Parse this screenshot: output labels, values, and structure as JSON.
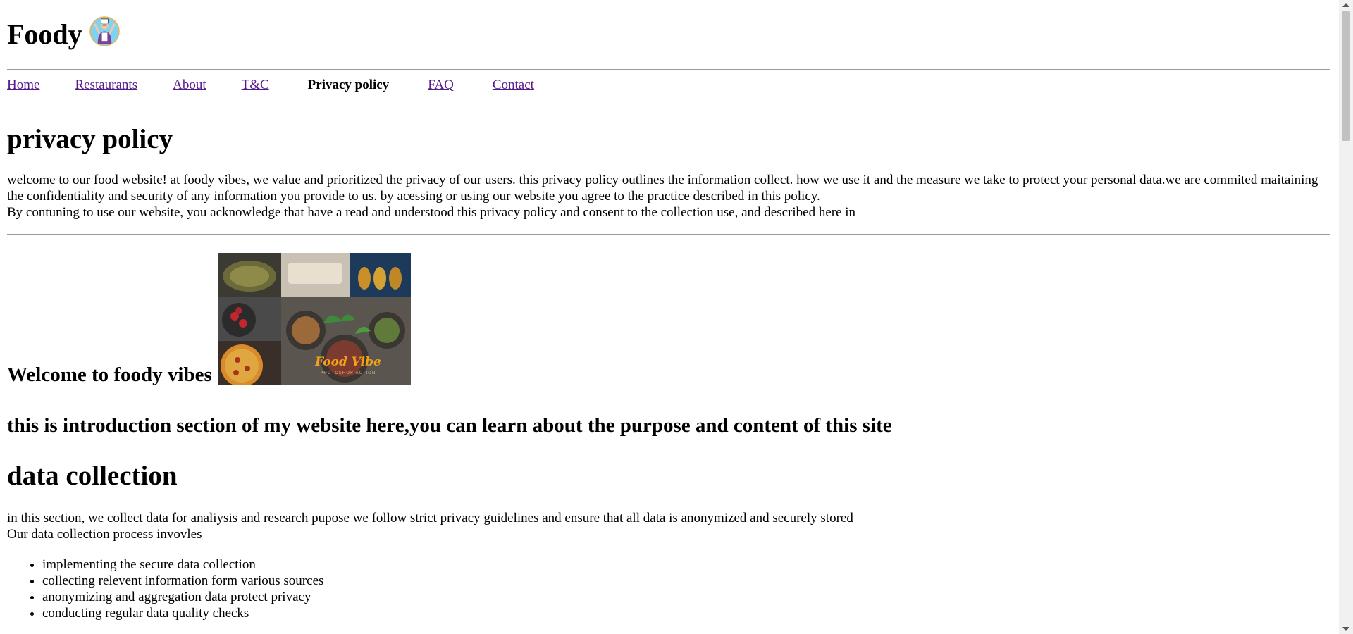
{
  "header": {
    "title": "Foody",
    "logo_icon": "chef-avatar-icon"
  },
  "nav": {
    "items": [
      "Home",
      "Restaurants",
      "About",
      "T&C"
    ],
    "active": "Privacy policy",
    "items_after": [
      "FAQ",
      "Contact"
    ]
  },
  "privacy": {
    "heading": "privacy policy",
    "paragraph_line1": "welcome to our food website! at foody vibes, we value and prioritized the privacy of our users. this privacy policy outlines the information collect. how we use it and the measure we take to protect your personal data.we are commited maitaining the confidentiality and security of any information you provide to us. by acessing or using our website you agree to the practice described in this policy.",
    "paragraph_line2": "By contuning to use our website, you acknowledge that have a read and understood this privacy policy and consent to the collection use, and described here in"
  },
  "welcome": {
    "heading": "Welcome to foody vibes",
    "image_text": "Food Vibe",
    "image_subtext": "PHOTOSHOP ACTION",
    "intro": "this is introduction section of my website here,you can learn about the purpose and content of this site"
  },
  "data_collection": {
    "heading": "data collection",
    "line1": "in this section, we collect data for analiysis and research pupose we follow strict privacy guidelines and ensure that all data is anonymized and securely stored",
    "line2": "Our data collection process invovles",
    "items": [
      "implementing the secure data collection",
      "collecting relevent information form various sources",
      "anonymizing and aggregation data protect privacy",
      "conducting regular data quality checks"
    ]
  },
  "colors": {
    "link": "#551a8b",
    "rule": "#9a9a9a",
    "brand_text": "#f5a21b"
  }
}
